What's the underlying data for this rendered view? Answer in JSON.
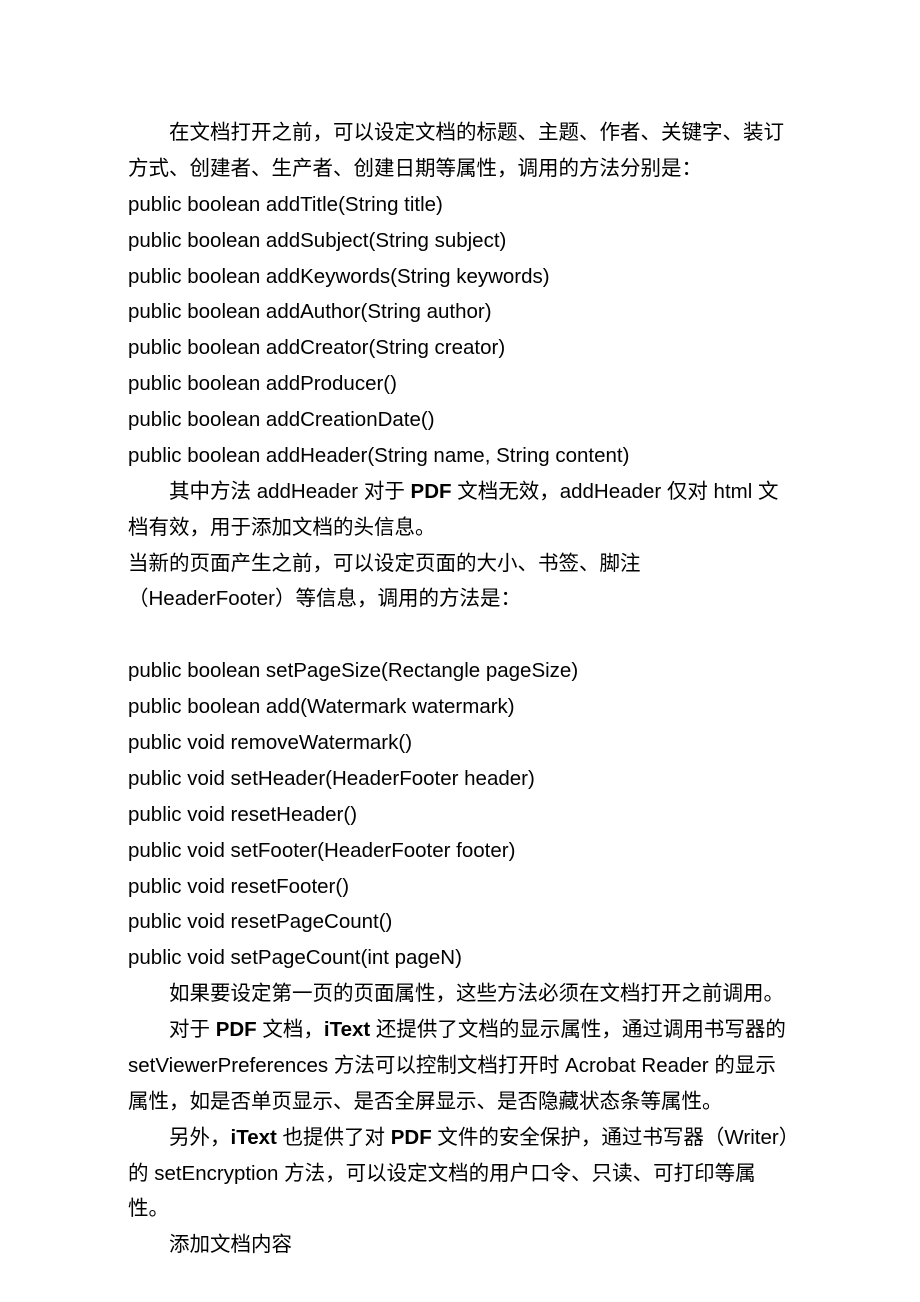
{
  "p1": "在文档打开之前，可以设定文档的标题、主题、作者、关键字、装订方式、创建者、生产者、创建日期等属性，调用的方法分别是：",
  "code1": [
    "public boolean addTitle(String title)",
    "public boolean addSubject(String subject)",
    "public boolean addKeywords(String keywords)",
    "public boolean addAuthor(String author)",
    "public boolean addCreator(String creator)",
    "public boolean addProducer()",
    "public boolean addCreationDate()",
    "public boolean addHeader(String name, String content)"
  ],
  "p2_pre": "其中方法 addHeader 对于 ",
  "p2_b1": "PDF",
  "p2_mid": " 文档无效，addHeader 仅对 html 文档有效，用于添加文档的头信息。",
  "p3": "当新的页面产生之前，可以设定页面的大小、书签、脚注（HeaderFooter）等信息，调用的方法是：",
  "code2": [
    "public boolean setPageSize(Rectangle pageSize)",
    "public boolean add(Watermark watermark)",
    "public void removeWatermark()",
    "public void setHeader(HeaderFooter header)",
    "public void resetHeader()",
    "public void setFooter(HeaderFooter footer)",
    "public void resetFooter()",
    "public void resetPageCount()",
    "public void setPageCount(int pageN)"
  ],
  "p4": "如果要设定第一页的页面属性，这些方法必须在文档打开之前调用。",
  "p5_a": "对于 ",
  "p5_b1": "PDF",
  "p5_b": " 文档，",
  "p5_b2": "iText",
  "p5_c": " 还提供了文档的显示属性，通过调用书写器的 setViewerPreferences 方法可以控制文档打开时 Acrobat Reader 的显示属性，如是否单页显示、是否全屏显示、是否隐藏状态条等属性。",
  "p6_a": "另外，",
  "p6_b1": "iText",
  "p6_b": " 也提供了对 ",
  "p6_b2": "PDF",
  "p6_c": " 文件的安全保护，通过书写器（Writer）的 setEncryption 方法，可以设定文档的用户口令、只读、可打印等属性。",
  "p7": "添加文档内容"
}
